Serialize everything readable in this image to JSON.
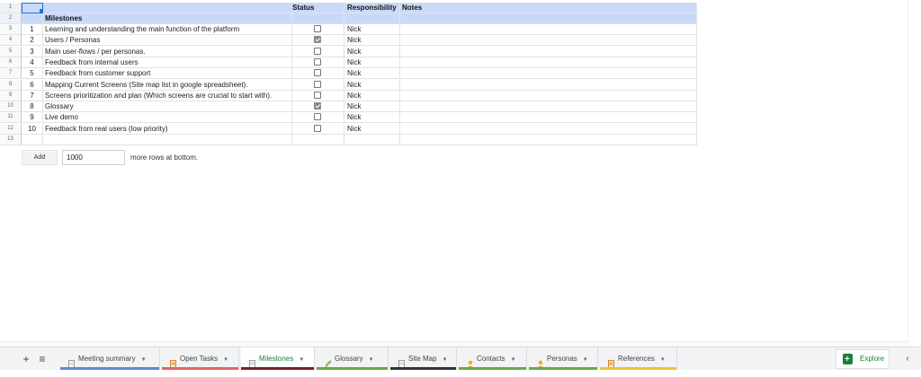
{
  "header": {
    "milestones_label": "Milestones",
    "status_label": "Status",
    "responsibility_label": "Responsibility",
    "notes_label": "Notes"
  },
  "rows": [
    {
      "num": "1",
      "task": "Learning and understanding the main function of the platform",
      "done": false,
      "owner": "Nick"
    },
    {
      "num": "2",
      "task": "Users / Personas",
      "done": true,
      "owner": "Nick"
    },
    {
      "num": "3",
      "task": "Main user-flows / per personas.",
      "done": false,
      "owner": "Nick"
    },
    {
      "num": "4",
      "task": "Feedback from internal users",
      "done": false,
      "owner": "Nick"
    },
    {
      "num": "5",
      "task": "Feedback from customer support",
      "done": false,
      "owner": "Nick"
    },
    {
      "num": "6",
      "task": "Mapping Current Screens (Site map list in google spreadsheet).",
      "done": false,
      "owner": "Nick"
    },
    {
      "num": "7",
      "task": "Screens prioritization and plan (Which screens are crucial to start with).",
      "done": false,
      "owner": "Nick"
    },
    {
      "num": "8",
      "task": "Glossary",
      "done": true,
      "owner": "Nick"
    },
    {
      "num": "9",
      "task": "Live demo",
      "done": false,
      "owner": "Nick"
    },
    {
      "num": "10",
      "task": "Feedback from real users (low priority)",
      "done": false,
      "owner": "Nick"
    }
  ],
  "row_numbers": [
    "1",
    "2",
    "3",
    "4",
    "5",
    "6",
    "7",
    "8",
    "9",
    "10",
    "11",
    "12",
    "13"
  ],
  "add_rows": {
    "button_label": "Add",
    "count_value": "1000",
    "suffix_text": "more rows at bottom."
  },
  "tabs": [
    {
      "label": "Meeting summary",
      "icon": "doc-icon",
      "underline": "#5b8bd1",
      "active": false
    },
    {
      "label": "Open Tasks",
      "icon": "list-icon",
      "underline": "#e06666",
      "active": false
    },
    {
      "label": "Milestones",
      "icon": "doc-icon",
      "underline": "#7b1f2a",
      "active": true
    },
    {
      "label": "Glossary",
      "icon": "pencil-icon",
      "underline": "#6aa84f",
      "active": false
    },
    {
      "label": "Site Map",
      "icon": "doc-icon",
      "underline": "#333333",
      "active": false
    },
    {
      "label": "Contacts",
      "icon": "person-icon",
      "underline": "#6aa84f",
      "active": false
    },
    {
      "label": "Personas",
      "icon": "person-icon",
      "underline": "#6aa84f",
      "active": false
    },
    {
      "label": "References",
      "icon": "list-icon",
      "underline": "#f1c232",
      "active": false
    }
  ],
  "explore_label": "Explore",
  "colors": {
    "header_fill": "#c9daf8",
    "selection": "#1a73e8",
    "active_tab_text": "#188038"
  }
}
